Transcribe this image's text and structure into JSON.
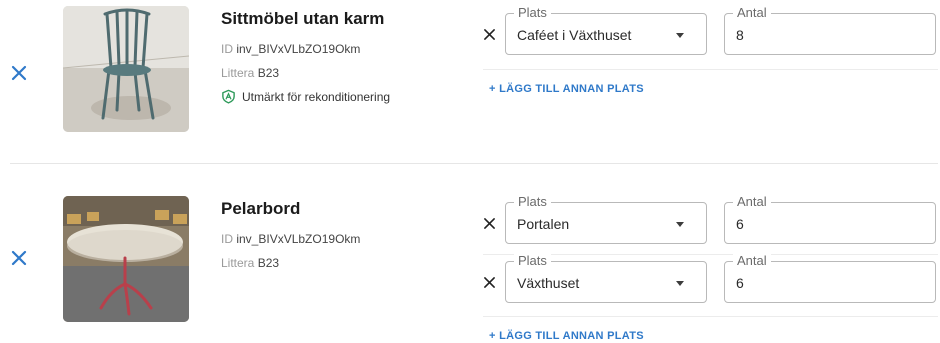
{
  "items": [
    {
      "title": "Sittmöbel utan karm",
      "id_label": "ID",
      "id_value": "inv_BIVxVLbZO19Okm",
      "littera_label": "Littera",
      "littera_value": "B23",
      "badge": "Utmärkt för rekonditionering",
      "locations": [
        {
          "place_label": "Plats",
          "place_value": "Caféet i Växthuset",
          "qty_label": "Antal",
          "qty_value": "8"
        }
      ],
      "add_location": "+ LÄGG TILL ANNAN PLATS"
    },
    {
      "title": "Pelarbord",
      "id_label": "ID",
      "id_value": "inv_BIVxVLbZO19Okm",
      "littera_label": "Littera",
      "littera_value": "B23",
      "locations": [
        {
          "place_label": "Plats",
          "place_value": "Portalen",
          "qty_label": "Antal",
          "qty_value": "6"
        },
        {
          "place_label": "Plats",
          "place_value": "Växthuset",
          "qty_label": "Antal",
          "qty_value": "6"
        }
      ],
      "add_location": "+ LÄGG TILL ANNAN PLATS"
    }
  ],
  "icons": {
    "remove_item": "close-icon",
    "remove_row": "close-icon",
    "badge": "shield-check-icon",
    "dropdown": "caret-down-icon"
  },
  "colors": {
    "accent": "#2f79c9",
    "badge_green": "#2e9a5a",
    "text": "#1f1f1f",
    "muted": "#9a9a9a"
  }
}
